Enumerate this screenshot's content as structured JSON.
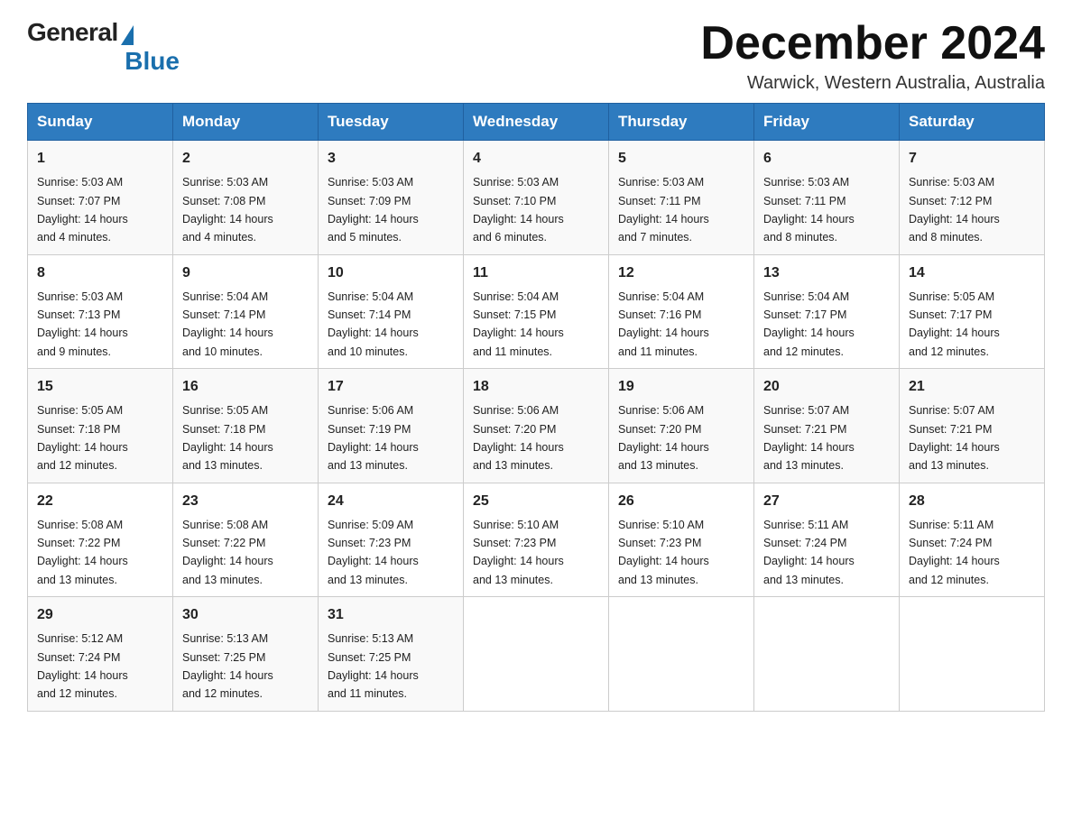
{
  "logo": {
    "general": "General",
    "blue": "Blue"
  },
  "title": "December 2024",
  "location": "Warwick, Western Australia, Australia",
  "days_of_week": [
    "Sunday",
    "Monday",
    "Tuesday",
    "Wednesday",
    "Thursday",
    "Friday",
    "Saturday"
  ],
  "weeks": [
    [
      {
        "day": "1",
        "sunrise": "5:03 AM",
        "sunset": "7:07 PM",
        "daylight": "14 hours and 4 minutes."
      },
      {
        "day": "2",
        "sunrise": "5:03 AM",
        "sunset": "7:08 PM",
        "daylight": "14 hours and 4 minutes."
      },
      {
        "day": "3",
        "sunrise": "5:03 AM",
        "sunset": "7:09 PM",
        "daylight": "14 hours and 5 minutes."
      },
      {
        "day": "4",
        "sunrise": "5:03 AM",
        "sunset": "7:10 PM",
        "daylight": "14 hours and 6 minutes."
      },
      {
        "day": "5",
        "sunrise": "5:03 AM",
        "sunset": "7:11 PM",
        "daylight": "14 hours and 7 minutes."
      },
      {
        "day": "6",
        "sunrise": "5:03 AM",
        "sunset": "7:11 PM",
        "daylight": "14 hours and 8 minutes."
      },
      {
        "day": "7",
        "sunrise": "5:03 AM",
        "sunset": "7:12 PM",
        "daylight": "14 hours and 8 minutes."
      }
    ],
    [
      {
        "day": "8",
        "sunrise": "5:03 AM",
        "sunset": "7:13 PM",
        "daylight": "14 hours and 9 minutes."
      },
      {
        "day": "9",
        "sunrise": "5:04 AM",
        "sunset": "7:14 PM",
        "daylight": "14 hours and 10 minutes."
      },
      {
        "day": "10",
        "sunrise": "5:04 AM",
        "sunset": "7:14 PM",
        "daylight": "14 hours and 10 minutes."
      },
      {
        "day": "11",
        "sunrise": "5:04 AM",
        "sunset": "7:15 PM",
        "daylight": "14 hours and 11 minutes."
      },
      {
        "day": "12",
        "sunrise": "5:04 AM",
        "sunset": "7:16 PM",
        "daylight": "14 hours and 11 minutes."
      },
      {
        "day": "13",
        "sunrise": "5:04 AM",
        "sunset": "7:17 PM",
        "daylight": "14 hours and 12 minutes."
      },
      {
        "day": "14",
        "sunrise": "5:05 AM",
        "sunset": "7:17 PM",
        "daylight": "14 hours and 12 minutes."
      }
    ],
    [
      {
        "day": "15",
        "sunrise": "5:05 AM",
        "sunset": "7:18 PM",
        "daylight": "14 hours and 12 minutes."
      },
      {
        "day": "16",
        "sunrise": "5:05 AM",
        "sunset": "7:18 PM",
        "daylight": "14 hours and 13 minutes."
      },
      {
        "day": "17",
        "sunrise": "5:06 AM",
        "sunset": "7:19 PM",
        "daylight": "14 hours and 13 minutes."
      },
      {
        "day": "18",
        "sunrise": "5:06 AM",
        "sunset": "7:20 PM",
        "daylight": "14 hours and 13 minutes."
      },
      {
        "day": "19",
        "sunrise": "5:06 AM",
        "sunset": "7:20 PM",
        "daylight": "14 hours and 13 minutes."
      },
      {
        "day": "20",
        "sunrise": "5:07 AM",
        "sunset": "7:21 PM",
        "daylight": "14 hours and 13 minutes."
      },
      {
        "day": "21",
        "sunrise": "5:07 AM",
        "sunset": "7:21 PM",
        "daylight": "14 hours and 13 minutes."
      }
    ],
    [
      {
        "day": "22",
        "sunrise": "5:08 AM",
        "sunset": "7:22 PM",
        "daylight": "14 hours and 13 minutes."
      },
      {
        "day": "23",
        "sunrise": "5:08 AM",
        "sunset": "7:22 PM",
        "daylight": "14 hours and 13 minutes."
      },
      {
        "day": "24",
        "sunrise": "5:09 AM",
        "sunset": "7:23 PM",
        "daylight": "14 hours and 13 minutes."
      },
      {
        "day": "25",
        "sunrise": "5:10 AM",
        "sunset": "7:23 PM",
        "daylight": "14 hours and 13 minutes."
      },
      {
        "day": "26",
        "sunrise": "5:10 AM",
        "sunset": "7:23 PM",
        "daylight": "14 hours and 13 minutes."
      },
      {
        "day": "27",
        "sunrise": "5:11 AM",
        "sunset": "7:24 PM",
        "daylight": "14 hours and 13 minutes."
      },
      {
        "day": "28",
        "sunrise": "5:11 AM",
        "sunset": "7:24 PM",
        "daylight": "14 hours and 12 minutes."
      }
    ],
    [
      {
        "day": "29",
        "sunrise": "5:12 AM",
        "sunset": "7:24 PM",
        "daylight": "14 hours and 12 minutes."
      },
      {
        "day": "30",
        "sunrise": "5:13 AM",
        "sunset": "7:25 PM",
        "daylight": "14 hours and 12 minutes."
      },
      {
        "day": "31",
        "sunrise": "5:13 AM",
        "sunset": "7:25 PM",
        "daylight": "14 hours and 11 minutes."
      },
      null,
      null,
      null,
      null
    ]
  ],
  "labels": {
    "sunrise": "Sunrise:",
    "sunset": "Sunset:",
    "daylight": "Daylight:"
  }
}
